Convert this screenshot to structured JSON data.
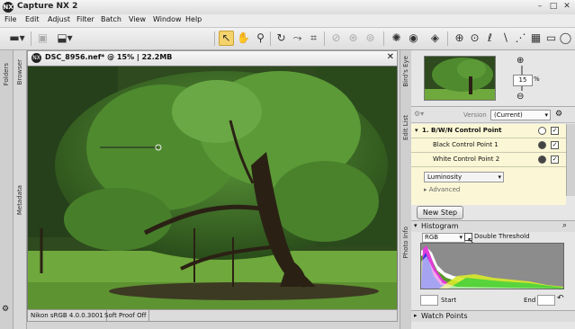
{
  "app": {
    "title": "Capture NX 2",
    "logo_text": "NX"
  },
  "window_controls": {
    "minimize": "–",
    "maximize": "□",
    "close": "✕"
  },
  "menu": [
    "File",
    "Edit",
    "Adjust",
    "Filter",
    "Batch",
    "View",
    "Window",
    "Help"
  ],
  "document": {
    "title": "DSC_8956.nef* @ 15% | 22.2MB",
    "close": "✕",
    "status": {
      "profile": "Nikon sRGB 4.0.0.3001",
      "proof": "Soft Proof Off"
    }
  },
  "left_tabs": {
    "folders": "Folders",
    "browser": "Browser",
    "metadata": "Metadata"
  },
  "right_tabs": {
    "birds_eye": "Bird's Eye",
    "edit_list": "Edit List",
    "photo_info": "Photo Info"
  },
  "birds_eye": {
    "zoom_value": "15",
    "zoom_unit": "%"
  },
  "edit_list": {
    "version_label": "Version",
    "version_value": "(Current)",
    "step_title": "1. B/W/N Control Point",
    "points": [
      "Black Control Point 1",
      "White Control Point 2"
    ],
    "mode": "Luminosity",
    "advanced": "Advanced",
    "new_step": "New Step"
  },
  "histogram": {
    "header": "Histogram",
    "channel": "RGB",
    "double_threshold": "Double Threshold",
    "start_label": "Start",
    "end_label": "End"
  },
  "watch_points": {
    "header": "Watch Points"
  },
  "colors": {
    "selection": "#f5d36b",
    "edit_row": "#fbf7d6"
  }
}
